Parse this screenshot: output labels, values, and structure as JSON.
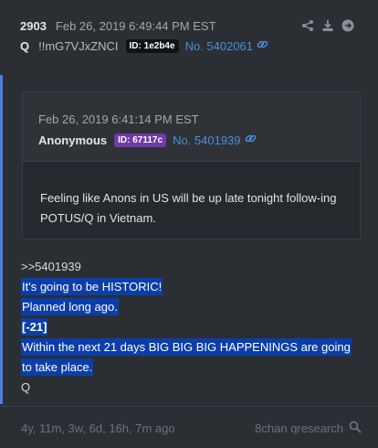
{
  "post": {
    "number": "2903",
    "date": "Feb 26, 2019 6:49:44 PM EST",
    "author": "Q",
    "tripcode": "!!mG7VJxZNCI",
    "id_badge": "ID: 1e2b4e",
    "post_link": "No. 5402061"
  },
  "reference": {
    "date": "Feb 26, 2019 6:41:14 PM EST",
    "author": "Anonymous",
    "id_badge": "ID: 67117c",
    "post_link": "No. 5401939",
    "text": "Feeling like Anons in US will be up late tonight follow-ing POTUS/Q in Vietnam."
  },
  "body": {
    "reply_ref": ">>5401939",
    "line1": "It's going to be HISTORIC!",
    "line2": "Planned long ago.",
    "line3": "[-21]",
    "line4a": "Within the next 21 days BIG BIG BIG HAPPENINGS are going",
    "line4b": "to take place.",
    "signature": "Q"
  },
  "footer": {
    "age": "4y, 11m, 3w, 6d, 16h, 7m ago",
    "source": "8chan qresearch"
  },
  "colors": {
    "background": "#2b2e33",
    "link": "#4a90d9",
    "highlight": "#0b3ea8",
    "accent": "#4a7fe0",
    "purple_badge": "#6e3aa8"
  }
}
